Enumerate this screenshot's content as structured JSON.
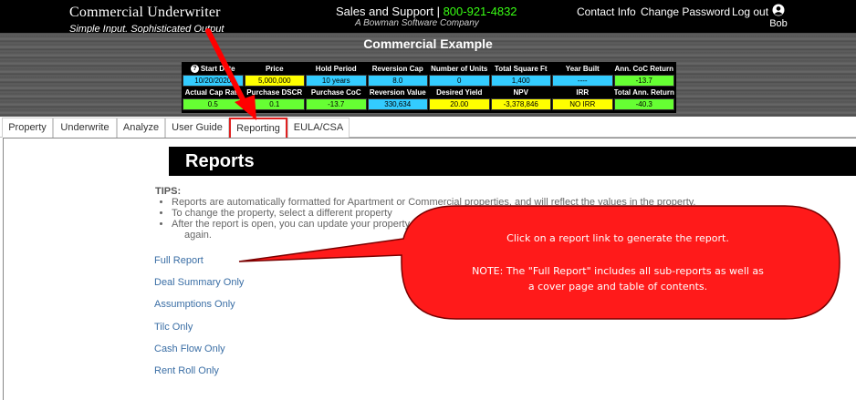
{
  "header": {
    "brand_name": "Commercial Underwriter",
    "brand_tagline": "Simple Input. Sophisticated Output",
    "support_label": "Sales and Support |",
    "support_phone": "800-921-4832",
    "company": "A Bowman Software Company",
    "nav": {
      "contact": "Contact Info",
      "change_password": "Change Password",
      "logout": "Log out"
    },
    "user_name": "Bob",
    "user_icon": "user-circle-icon"
  },
  "example_title": "Commercial Example",
  "metrics": {
    "row1_labels": [
      "Start Date",
      "Price",
      "Hold Period",
      "Reversion Cap",
      "Number of Units",
      "Total Square Ft",
      "Year Built",
      "Ann. CoC Return"
    ],
    "row1_values": [
      "10/20/2020",
      "5,000,000",
      "10 years",
      "8.0",
      "0",
      "1,400",
      "----",
      "-13.7"
    ],
    "row2_labels": [
      "Actual Cap Rate",
      "Purchase DSCR",
      "Purchase CoC",
      "Reversion Value",
      "Desired Yield",
      "NPV",
      "IRR",
      "Total Ann. Return"
    ],
    "row2_values": [
      "0.5",
      "0.1",
      "-13.7",
      "330,634",
      "20.00",
      "-3,378,846",
      "NO IRR",
      "-40.3"
    ],
    "colors": {
      "blue": "#33ccff",
      "yellow": "#ffff00",
      "green": "#66ff33"
    }
  },
  "tabs": [
    {
      "label": "Property"
    },
    {
      "label": "Underwrite"
    },
    {
      "label": "Analyze"
    },
    {
      "label": "User Guide"
    },
    {
      "label": "Reporting",
      "active": true
    },
    {
      "label": "EULA/CSA"
    }
  ],
  "reports": {
    "title": "Reports",
    "tips_label": "TIPS:",
    "tips": [
      "Reports are automatically formatted for Apartment or Commercial properties, and will reflect the values in the property.",
      "To change the property, select a different property",
      "After the report is open, you can update your property and refresh the report again.",
      "again."
    ],
    "links": [
      "Full Report",
      "Deal Summary Only",
      "Assumptions Only",
      "Tilc Only",
      "Cash Flow Only",
      "Rent Roll Only"
    ]
  },
  "callout": {
    "line1": "Click on a report link to generate the report.",
    "line2": "NOTE: The \"Full Report\" includes all sub-reports as well as",
    "line3": "a cover page and table of contents.",
    "color": "#ff1a1a",
    "arrow_color": "#ff0000"
  }
}
